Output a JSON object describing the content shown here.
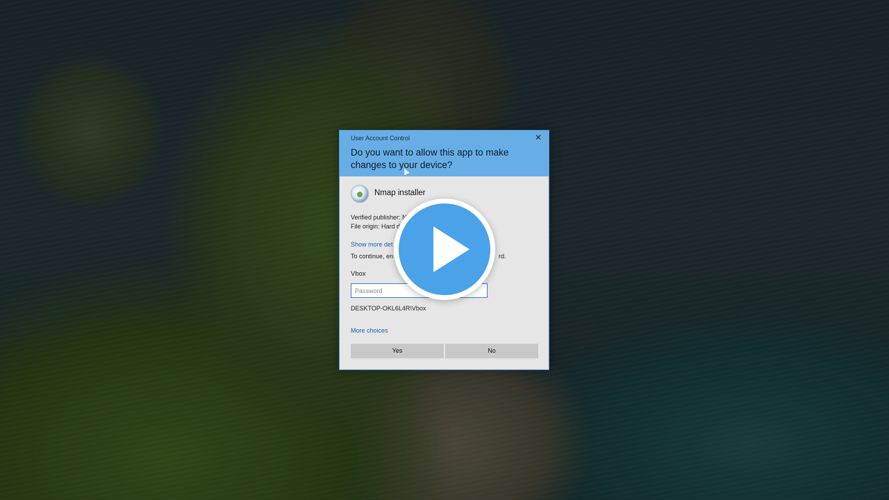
{
  "uac": {
    "window_title": "User Account Control",
    "question": "Do you want to allow this app to make changes to your device?",
    "app_name": "Nmap installer",
    "publisher_line": "Verified publisher: N",
    "origin_line": "File origin: Hard d",
    "show_more_link": "Show more det",
    "continue_text_start": "To continue, en",
    "continue_text_end": "rd.",
    "user_name": "Vbox",
    "password_placeholder": "Password",
    "account_label": "DESKTOP-OKL6L4R\\Vbox",
    "more_choices_link": "More choices",
    "yes_label": "Yes",
    "no_label": "No",
    "close_glyph": "✕",
    "header_color": "#68aee6",
    "link_color": "#1a5fb4"
  },
  "overlay": {
    "icon": "play-icon",
    "color": "#4aa2e8"
  }
}
